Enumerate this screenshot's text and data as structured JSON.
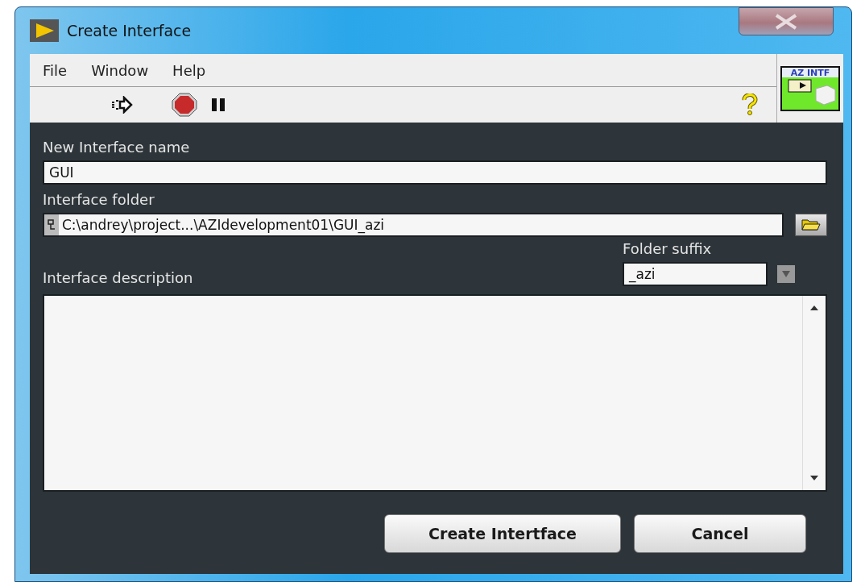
{
  "window": {
    "title": "Create Interface"
  },
  "menu": [
    "File",
    "Window",
    "Help"
  ],
  "vi_icon": {
    "label": "AZ INTF"
  },
  "form": {
    "name_label": "New Interface name",
    "name_value": "GUI",
    "folder_label": "Interface folder",
    "folder_value": "C:\\andrey\\project...\\AZIdevelopment01\\GUI_azi",
    "suffix_label": "Folder suffix",
    "suffix_value": "_azi",
    "description_label": "Interface description"
  },
  "buttons": [
    "Create Intertface",
    "Cancel"
  ]
}
